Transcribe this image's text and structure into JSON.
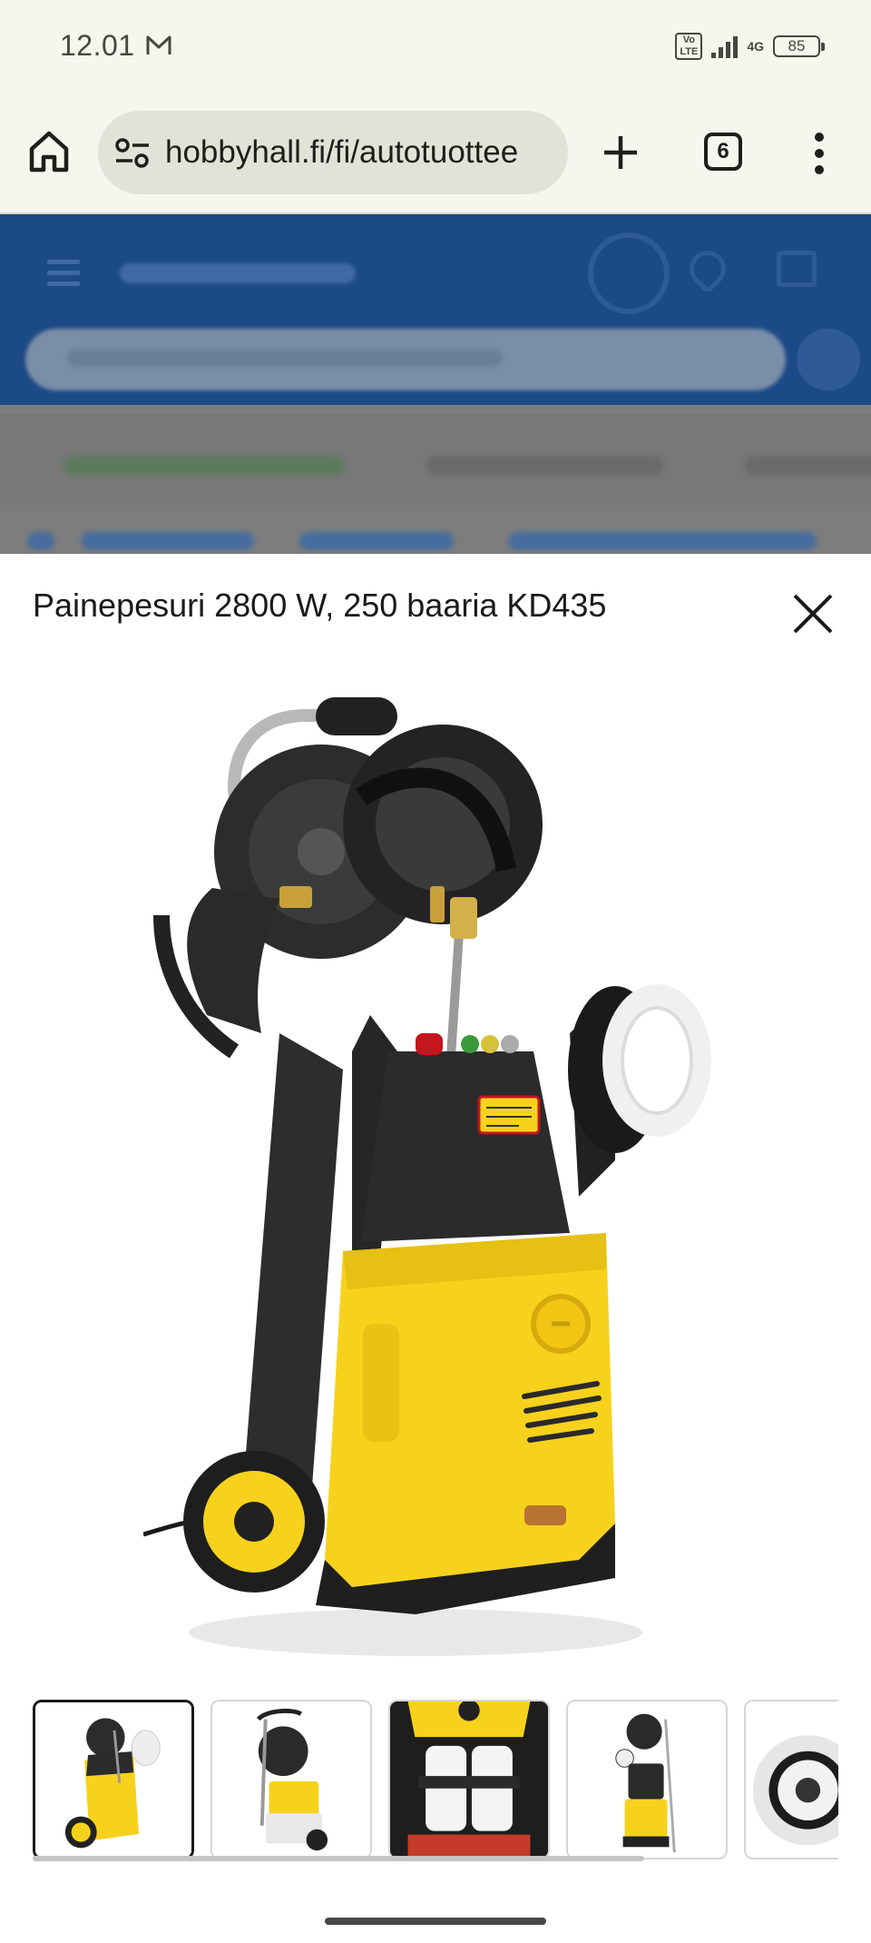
{
  "status_bar": {
    "time": "12.01",
    "volte": "Vo LTE",
    "network": "4G",
    "battery": "85"
  },
  "browser": {
    "url": "hobbyhall.fi/fi/autotuottee",
    "tab_count": "6"
  },
  "modal": {
    "title": "Painepesuri 2800 W, 250 baaria KD435",
    "thumbnails": [
      {
        "icon": "pressure-washer-front",
        "selected": true
      },
      {
        "icon": "pressure-washer-side",
        "selected": false
      },
      {
        "icon": "detergent-tanks",
        "selected": false
      },
      {
        "icon": "pressure-washer-full",
        "selected": false
      },
      {
        "icon": "rotating-brush",
        "selected": false
      }
    ]
  },
  "colors": {
    "brand_blue": "#1c4a86",
    "product_yellow": "#f7d21c",
    "product_black": "#2b2b2b"
  }
}
